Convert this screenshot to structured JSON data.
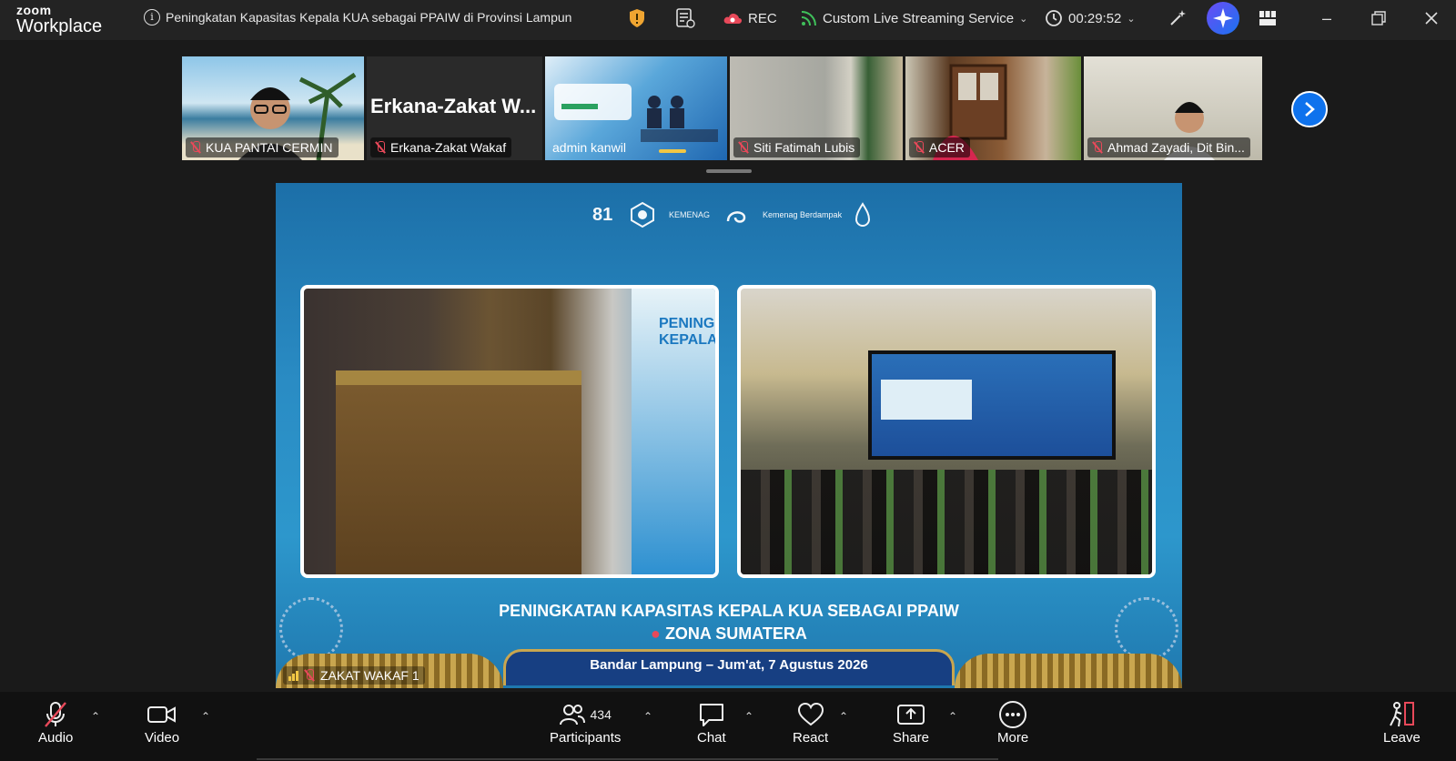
{
  "app": {
    "brand_top": "zoom",
    "brand_bottom": "Workplace"
  },
  "meeting": {
    "title": "Peningkatan Kapasitas Kepala KUA sebagai PPAIW di Provinsi Lampun"
  },
  "titlebar": {
    "rec_label": "REC",
    "stream_label": "Custom Live Streaming Service",
    "timer": "00:29:52"
  },
  "gallery": {
    "tiles": [
      {
        "name": "KUA PANTAI CERMIN"
      },
      {
        "name": "Erkana-Zakat Wakaf",
        "display_text": "Erkana-Zakat  W..."
      },
      {
        "name": "admin kanwil"
      },
      {
        "name": "Siti Fatimah Lubis"
      },
      {
        "name": "ACER"
      },
      {
        "name": "Ahmad Zayadi, Dit Bin..."
      }
    ]
  },
  "share": {
    "logos": [
      "81",
      "KEMENAG",
      "Kemenag Berdampak"
    ],
    "poster_text": "PENING KEPALA",
    "title": "PENINGKATAN KAPASITAS KEPALA KUA SEBAGAI PPAIW",
    "subtitle": "ZONA SUMATERA",
    "location": "Bandar Lampung – Jum'at, 7 Agustus 2026",
    "speaker_label": "ZAKAT WAKAF 1"
  },
  "toolbar": {
    "audio": "Audio",
    "video": "Video",
    "participants": "Participants",
    "participant_count": "434",
    "chat": "Chat",
    "react": "React",
    "share": "Share",
    "more": "More",
    "leave": "Leave"
  },
  "colors": {
    "accent": "#0e72ed",
    "muted_red": "#e8495a",
    "background": "#1a1a1a"
  }
}
